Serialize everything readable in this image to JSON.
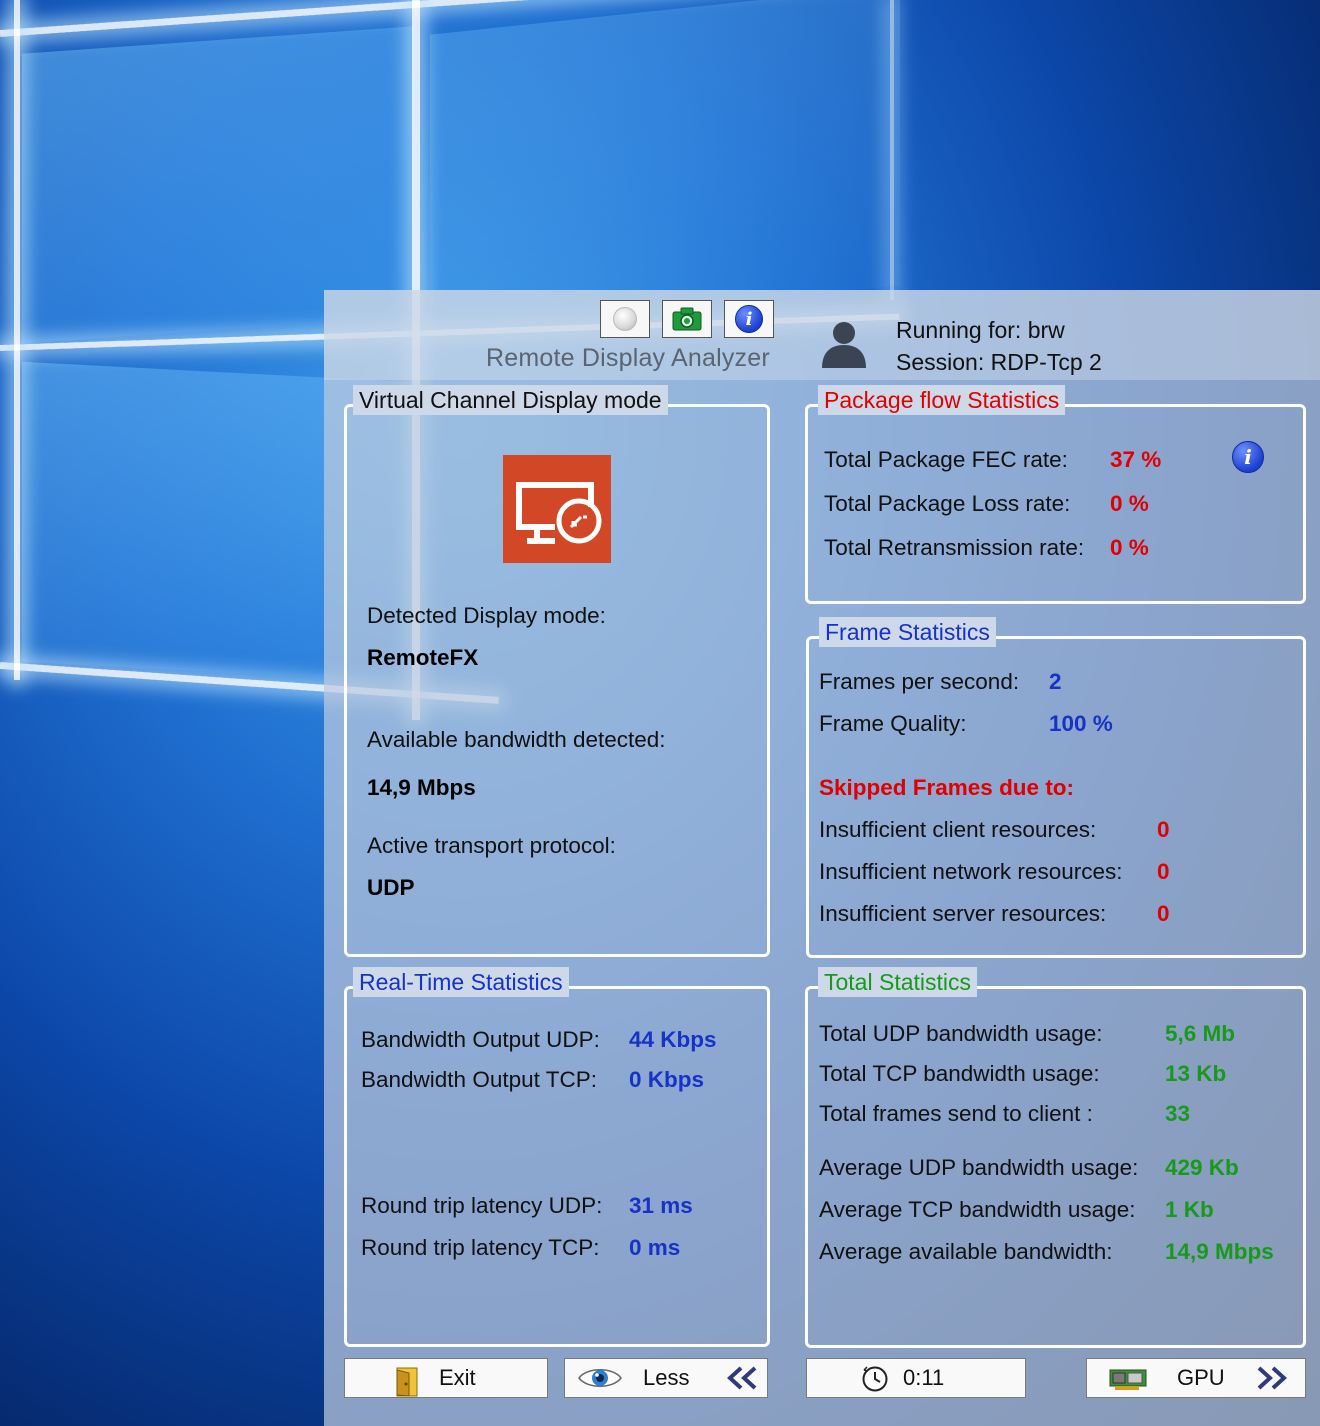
{
  "header": {
    "app_title": "Remote Display Analyzer",
    "toolbar": [
      {
        "name": "record-button",
        "icon": "white-sphere-icon"
      },
      {
        "name": "screenshot-button",
        "icon": "camera-icon"
      },
      {
        "name": "about-button",
        "icon": "info-icon"
      }
    ],
    "running_for": "Running for: brw",
    "session": "Session: RDP-Tcp 2"
  },
  "display_mode": {
    "title": "Virtual Channel Display mode",
    "icon": "remote-desktop-icon",
    "detected_label": "Detected Display mode:",
    "detected_value": "RemoteFX",
    "bandwidth_label": "Available bandwidth detected:",
    "bandwidth_value": "14,9 Mbps",
    "protocol_label": "Active transport protocol:",
    "protocol_value": "UDP"
  },
  "package_flow": {
    "title": "Package flow Statistics",
    "fec_label": "Total Package FEC rate:",
    "fec_value": "37 %",
    "loss_label": "Total Package Loss rate:",
    "loss_value": "0 %",
    "retrans_label": "Total Retransmission rate:",
    "retrans_value": "0 %"
  },
  "frame_stats": {
    "title": "Frame Statistics",
    "fps_label": "Frames per second:",
    "fps_value": "2",
    "quality_label": "Frame Quality:",
    "quality_value": "100 %",
    "skipped_heading": "Skipped Frames due to:",
    "client_label": "Insufficient client resources:",
    "client_value": "0",
    "network_label": "Insufficient network resources:",
    "network_value": "0",
    "server_label": "Insufficient server resources:",
    "server_value": "0"
  },
  "realtime": {
    "title": "Real-Time Statistics",
    "udp_out_label": "Bandwidth Output UDP:",
    "udp_out_value": "44 Kbps",
    "tcp_out_label": "Bandwidth Output TCP:",
    "tcp_out_value": "0 Kbps",
    "rtt_udp_label": "Round trip latency UDP:",
    "rtt_udp_value": "31 ms",
    "rtt_tcp_label": "Round trip latency TCP:",
    "rtt_tcp_value": "0 ms"
  },
  "totals": {
    "title": "Total Statistics",
    "udp_total_label": "Total UDP bandwidth usage:",
    "udp_total_value": "5,6 Mb",
    "tcp_total_label": "Total TCP bandwidth usage:",
    "tcp_total_value": "13 Kb",
    "frames_label": "Total frames send to client :",
    "frames_value": "33",
    "avg_udp_label": "Average UDP bandwidth usage:",
    "avg_udp_value": "429 Kb",
    "avg_tcp_label": "Average TCP bandwidth usage:",
    "avg_tcp_value": "1 Kb",
    "avg_bw_label": "Average available bandwidth:",
    "avg_bw_value": "14,9 Mbps"
  },
  "footer": {
    "exit_label": "Exit",
    "less_label": "Less",
    "timer_label": "0:11",
    "gpu_label": "GPU"
  },
  "colors": {
    "red": "#e00000",
    "blue": "#1632c8",
    "green": "#179a1a",
    "rdp_orange": "#d24726"
  }
}
